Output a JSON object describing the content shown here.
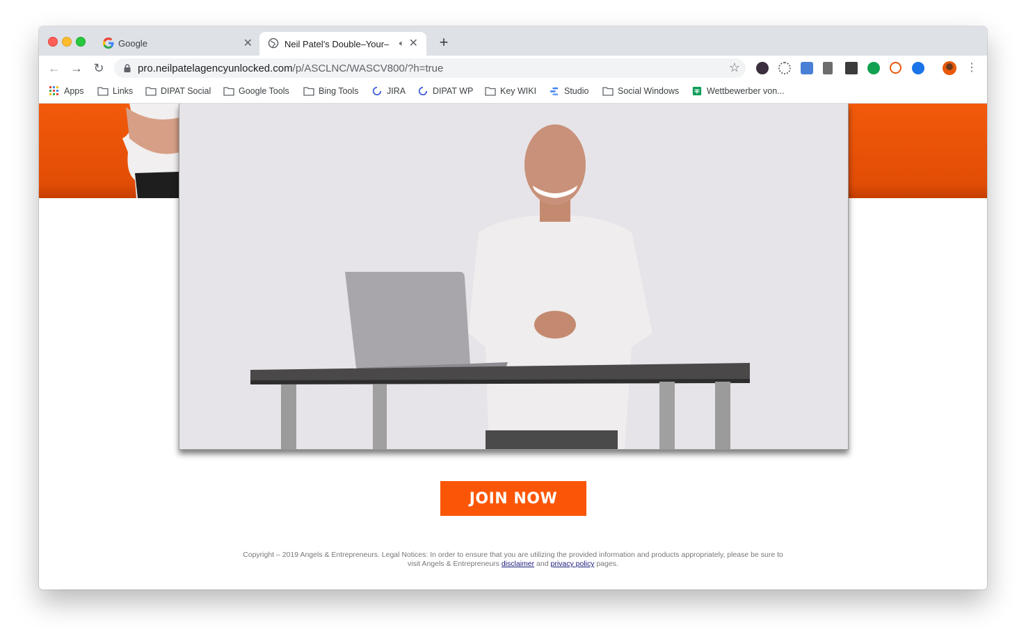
{
  "browser": {
    "tabs": [
      {
        "title": "Google",
        "active": false
      },
      {
        "title": "Neil Patel’s Double–Your–T",
        "active": true
      }
    ],
    "url_host": "pro.neilpatelagencyunlocked.com",
    "url_path": "/p/ASCLNC/WASCV800/?h=true"
  },
  "bookmarks": [
    {
      "label": "Apps",
      "icon": "apps-grid-icon"
    },
    {
      "label": "Links",
      "icon": "folder-icon"
    },
    {
      "label": "DIPAT Social",
      "icon": "folder-icon"
    },
    {
      "label": "Google Tools",
      "icon": "folder-icon"
    },
    {
      "label": "Bing Tools",
      "icon": "folder-icon"
    },
    {
      "label": "JIRA",
      "icon": "loading-icon"
    },
    {
      "label": "DIPAT WP",
      "icon": "loading-icon"
    },
    {
      "label": "Key WIKI",
      "icon": "folder-icon"
    },
    {
      "label": "Studio",
      "icon": "studio-icon"
    },
    {
      "label": "Social Windows",
      "icon": "folder-icon"
    },
    {
      "label": "Wettbewerber von...",
      "icon": "sheets-icon"
    }
  ],
  "page": {
    "cta_label": "JOIN NOW",
    "footer_text": "Copyright – 2019 Angels & Entrepreneurs. Legal Notices: In order to ensure that you are utilizing the provided information and products appropriately, please be sure to visit Angels & Entrepreneurs",
    "footer_link1": "disclaimer",
    "footer_and": "and",
    "footer_link2": "privacy policy",
    "footer_end": "pages."
  },
  "colors": {
    "brand_orange": "#fb5607",
    "band_orange": "#e9530a"
  }
}
